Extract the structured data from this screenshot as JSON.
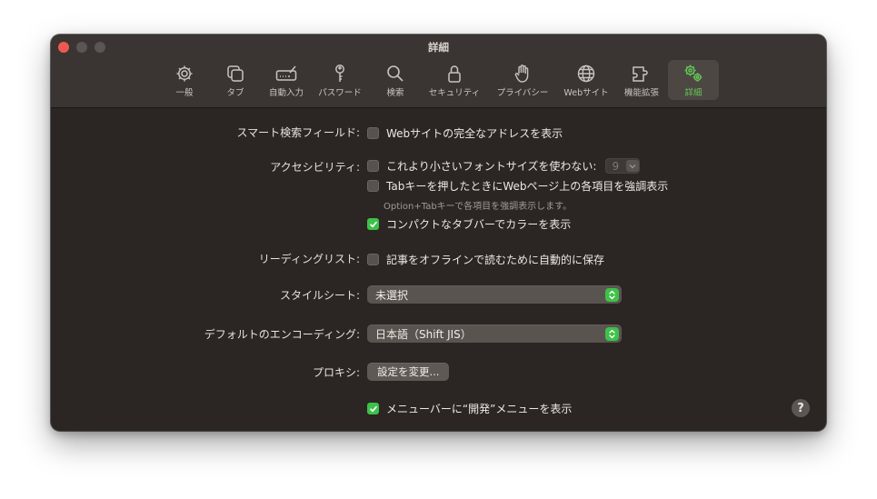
{
  "window": {
    "title": "詳細"
  },
  "toolbar": {
    "tabs": [
      {
        "label": "一般",
        "icon": "gear-icon",
        "active": false
      },
      {
        "label": "タブ",
        "icon": "tabs-icon",
        "active": false
      },
      {
        "label": "自動入力",
        "icon": "autofill-icon",
        "active": false
      },
      {
        "label": "パスワード",
        "icon": "key-icon",
        "active": false
      },
      {
        "label": "検索",
        "icon": "search-icon",
        "active": false
      },
      {
        "label": "セキュリティ",
        "icon": "lock-icon",
        "active": false
      },
      {
        "label": "プライバシー",
        "icon": "hand-icon",
        "active": false
      },
      {
        "label": "Webサイト",
        "icon": "globe-icon",
        "active": false
      },
      {
        "label": "機能拡張",
        "icon": "puzzle-icon",
        "active": false
      },
      {
        "label": "詳細",
        "icon": "gears-icon",
        "active": true
      }
    ],
    "accent_color": "#62c554"
  },
  "settings": {
    "smart_search": {
      "label": "スマート検索フィールド:",
      "option": "Webサイトの完全なアドレスを表示",
      "checked": false
    },
    "accessibility": {
      "label": "アクセシビリティ:",
      "min_font_option": "これより小さいフォントサイズを使わない:",
      "min_font_checked": false,
      "min_font_value": "9",
      "tab_highlight_option": "Tabキーを押したときにWebページ上の各項目を強調表示",
      "tab_highlight_checked": false,
      "tab_highlight_hint": "Option+Tabキーで各項目を強調表示します。",
      "compact_tab_option": "コンパクトなタブバーでカラーを表示",
      "compact_tab_checked": true
    },
    "reading_list": {
      "label": "リーディングリスト:",
      "option": "記事をオフラインで読むために自動的に保存",
      "checked": false
    },
    "stylesheet": {
      "label": "スタイルシート:",
      "value": "未選択"
    },
    "encoding": {
      "label": "デフォルトのエンコーディング:",
      "value": "日本語（Shift JIS）"
    },
    "proxy": {
      "label": "プロキシ:",
      "button": "設定を変更..."
    },
    "develop_menu": {
      "option": "メニューバーに“開発”メニューを表示",
      "checked": true
    }
  },
  "help": {
    "label": "?"
  },
  "colors": {
    "checkbox_on": "#3ec149",
    "window_bg": "#2b2624",
    "close": "#ee5a52"
  }
}
